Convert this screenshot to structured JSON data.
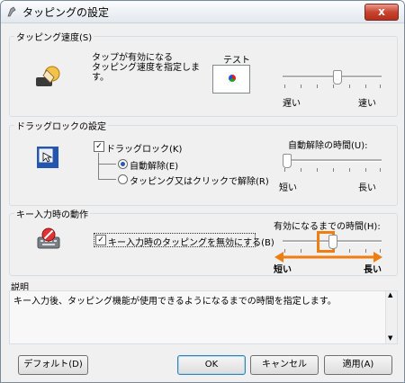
{
  "window": {
    "title": "タッピングの設定",
    "close_glyph": "x"
  },
  "tap_speed": {
    "group_label": "タッピング速度(S)",
    "description": "タップが有効になる\nタッピング速度を指定しま\nす。",
    "test_label": "テスト",
    "slow_label": "遅い",
    "fast_label": "速い",
    "slider_value": 0.55
  },
  "drag_lock": {
    "group_label": "ドラッグロックの設定",
    "checkbox_label": "ドラッグロック(K)",
    "checked": true,
    "radio_auto_label": "自動解除(E)",
    "radio_tap_label": "タッピング又はクリックで解除(R)",
    "selected_radio": "auto",
    "time_label": "自動解除の時間(U):",
    "short_label": "短い",
    "long_label": "長い",
    "slider_value": 0.0
  },
  "key_input": {
    "group_label": "キー入力時の動作",
    "checkbox_label": "キー入力時のタッピングを無効にする(B)",
    "checked": true,
    "time_label": "有効になるまでの時間(H):",
    "short_label": "短い",
    "long_label": "長い",
    "slider_value": 0.5,
    "highlight_color": "#f07d10"
  },
  "explanation": {
    "label": "説明",
    "text": "キー入力後、タッピング機能が使用できるようになるまでの時間を指定します。"
  },
  "buttons": {
    "default_label": "デフォルト(D)",
    "ok_label": "OK",
    "cancel_label": "キャンセル",
    "apply_label": "適用(A)"
  }
}
